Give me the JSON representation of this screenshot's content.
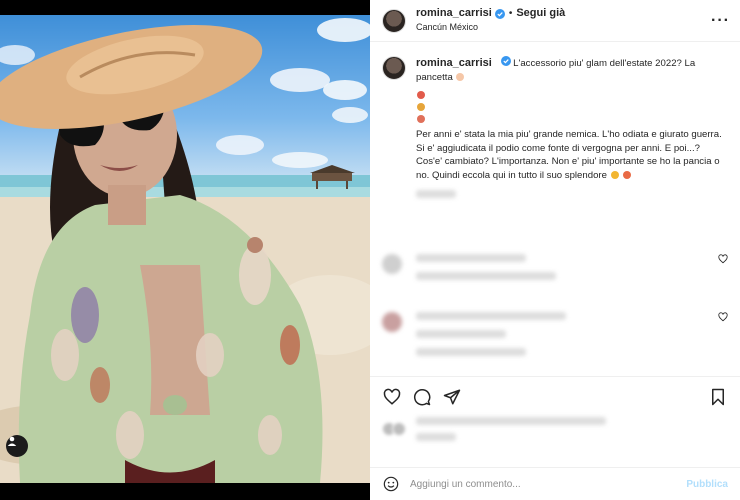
{
  "post": {
    "username": "romina_carrisi",
    "follow_label": "Segui già",
    "separator": "•",
    "location": "Cancún México",
    "more_icon": "more-options-icon",
    "caption_line1": "L'accessorio piu' glam dell'estate 2022? La pancetta",
    "caption_body": "Per anni e' stata la mia piu' grande nemica. L'ho odiata e giurato guerra. Si e' aggiudicata il podio come fonte di vergogna per anni. E poi...?Cos'e' cambiato? L'importanza. Non e' piu' importante se ho la pancia o no. Quindi eccola qui in tutto il suo splendore"
  },
  "actions": {
    "like_icon": "heart-icon",
    "comment_icon": "comment-icon",
    "share_icon": "share-icon",
    "save_icon": "bookmark-icon"
  },
  "comment_bar": {
    "placeholder": "Aggiungi un commento...",
    "post_label": "Pubblica"
  },
  "colors": {
    "verified": "#3897f0",
    "post_button": "#b2dffc",
    "text": "#262626",
    "muted": "#8e8e8e"
  }
}
